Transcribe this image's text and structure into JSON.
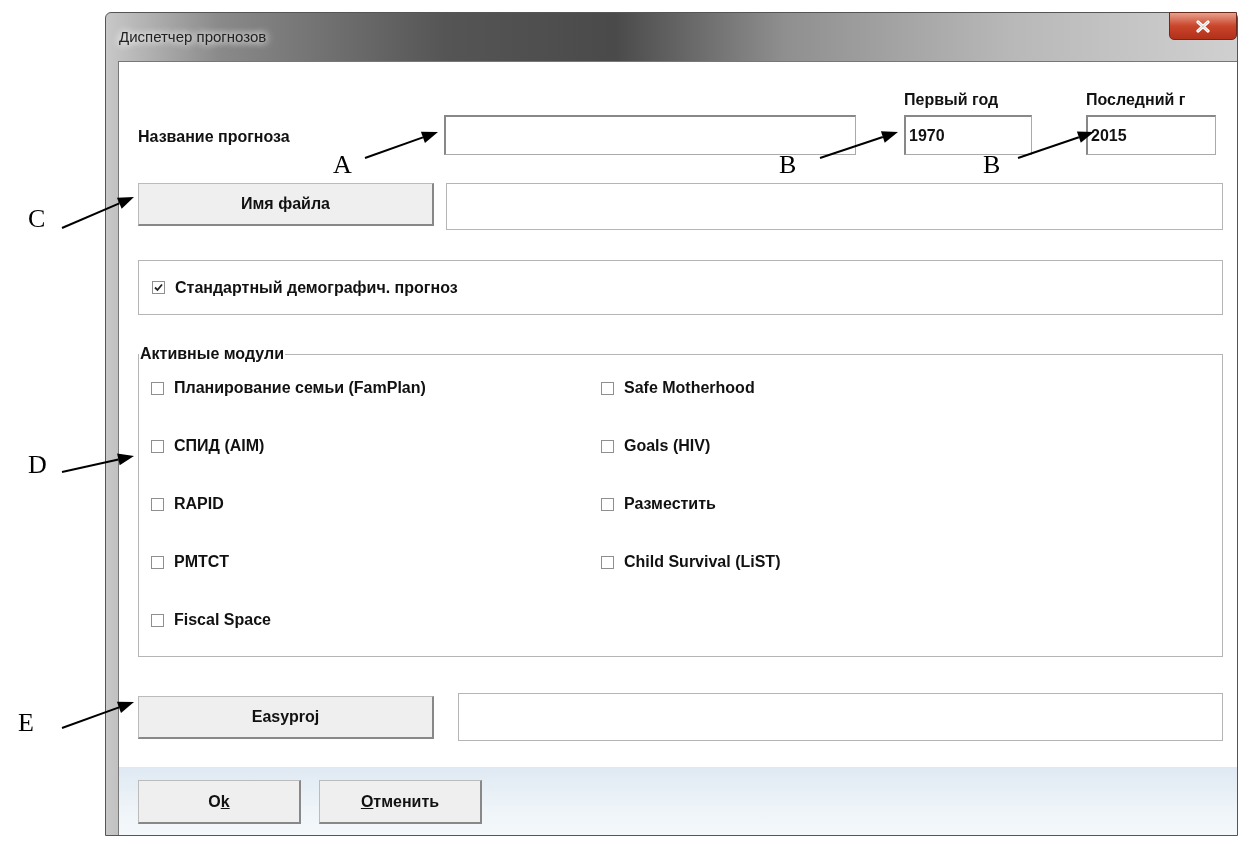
{
  "window": {
    "title": "Диспетчер прогнозов"
  },
  "name_label": "Название прогноза",
  "first_year": {
    "label": "Первый год",
    "value": "1970"
  },
  "last_year": {
    "label": "Последний г",
    "value": "2015"
  },
  "file_button": "Имя файла",
  "standard": {
    "label": "Стандартный демографич. прогноз",
    "checked": true
  },
  "modules": {
    "title": "Активные модули",
    "items": [
      {
        "label": "Планирование семьи (FamPlan)",
        "checked": false
      },
      {
        "label": "СПИД (AIM)",
        "checked": false
      },
      {
        "label": "RAPID",
        "checked": false
      },
      {
        "label": "PMTCT",
        "checked": false
      },
      {
        "label": "Fiscal Space",
        "checked": false
      },
      {
        "label": "Safe Motherhood",
        "checked": false
      },
      {
        "label": "Goals (HIV)",
        "checked": false
      },
      {
        "label": "Разместить",
        "checked": false
      },
      {
        "label": "Child Survival (LiST)",
        "checked": false
      }
    ]
  },
  "easyproj_button": "Easyproj",
  "buttons": [
    {
      "before": "O",
      "mnemonic": "k"
    },
    {
      "mnemonic": "О",
      "after": "тменить"
    }
  ],
  "annotations": [
    {
      "letter": "A"
    },
    {
      "letter": "B"
    },
    {
      "letter": "B"
    },
    {
      "letter": "C"
    },
    {
      "letter": "D"
    },
    {
      "letter": "E"
    }
  ]
}
